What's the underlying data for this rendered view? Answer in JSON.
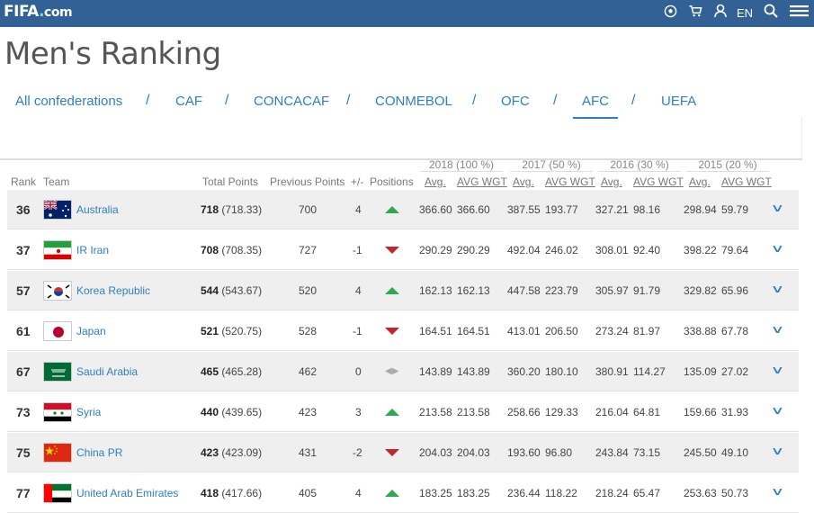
{
  "header": {
    "logo_text": "FIFA",
    "logo_dot": ".",
    "logo_com": "com",
    "lang": "EN",
    "icons": [
      "ball-icon",
      "cart-icon",
      "user-icon",
      "search-icon",
      "menu-icon"
    ]
  },
  "page": {
    "title": "Men's Ranking"
  },
  "tabs": [
    {
      "label": "All confederations"
    },
    {
      "label": "CAF"
    },
    {
      "label": "CONCACAF"
    },
    {
      "label": "CONMEBOL"
    },
    {
      "label": "OFC"
    },
    {
      "label": "AFC",
      "active": true
    },
    {
      "label": "UEFA"
    }
  ],
  "tab_separator": "/",
  "table": {
    "headers": {
      "rank": "Rank",
      "team": "Team",
      "total": "Total Points",
      "previous": "Previous Points",
      "change": "+/-",
      "positions": "Positions",
      "avg": "Avg.",
      "avg_wgt": "AVG WGT"
    },
    "years": [
      "2018 (100 %)",
      "2017 (50 %)",
      "2016 (30 %)",
      "2015 (20 %)"
    ],
    "rows": [
      {
        "rank": "36",
        "team": "Australia",
        "flag": "au",
        "total": "718",
        "total_exact": "(718.33)",
        "previous": "700",
        "change": "4",
        "trend": "up",
        "vals": [
          "366.60",
          "366.60",
          "387.55",
          "193.77",
          "327.21",
          "98.16",
          "298.94",
          "59.79"
        ]
      },
      {
        "rank": "37",
        "team": "IR Iran",
        "flag": "ir",
        "total": "708",
        "total_exact": "(708.35)",
        "previous": "727",
        "change": "-1",
        "trend": "down",
        "vals": [
          "290.29",
          "290.29",
          "492.04",
          "246.02",
          "308.01",
          "92.40",
          "398.22",
          "79.64"
        ]
      },
      {
        "rank": "57",
        "team": "Korea Republic",
        "flag": "kr",
        "total": "544",
        "total_exact": "(543.67)",
        "previous": "520",
        "change": "4",
        "trend": "up",
        "vals": [
          "162.13",
          "162.13",
          "447.58",
          "223.79",
          "305.97",
          "91.79",
          "329.82",
          "65.96"
        ]
      },
      {
        "rank": "61",
        "team": "Japan",
        "flag": "jp",
        "total": "521",
        "total_exact": "(520.75)",
        "previous": "528",
        "change": "-1",
        "trend": "down",
        "vals": [
          "164.51",
          "164.51",
          "413.01",
          "206.50",
          "273.24",
          "81.97",
          "338.88",
          "67.78"
        ]
      },
      {
        "rank": "67",
        "team": "Saudi Arabia",
        "flag": "sa",
        "total": "465",
        "total_exact": "(465.28)",
        "previous": "462",
        "change": "0",
        "trend": "same",
        "vals": [
          "143.89",
          "143.89",
          "360.20",
          "180.10",
          "380.91",
          "114.27",
          "135.09",
          "27.02"
        ]
      },
      {
        "rank": "73",
        "team": "Syria",
        "flag": "sy",
        "total": "440",
        "total_exact": "(439.65)",
        "previous": "423",
        "change": "3",
        "trend": "up",
        "vals": [
          "213.58",
          "213.58",
          "258.66",
          "129.33",
          "216.04",
          "64.81",
          "159.66",
          "31.93"
        ]
      },
      {
        "rank": "75",
        "team": "China PR",
        "flag": "cn",
        "total": "423",
        "total_exact": "(423.09)",
        "previous": "431",
        "change": "-2",
        "trend": "down",
        "vals": [
          "204.03",
          "204.03",
          "193.60",
          "96.80",
          "243.84",
          "73.15",
          "245.50",
          "49.10"
        ]
      },
      {
        "rank": "77",
        "team": "United Arab Emirates",
        "flag": "ae",
        "total": "418",
        "total_exact": "(417.66)",
        "previous": "405",
        "change": "4",
        "trend": "up",
        "vals": [
          "183.25",
          "183.25",
          "236.44",
          "118.22",
          "218.24",
          "65.47",
          "253.63",
          "50.73"
        ]
      }
    ]
  },
  "colors": {
    "topbar": "#326295",
    "link": "#2d7fc1",
    "up": "#2fa84f",
    "down": "#c0272d"
  }
}
